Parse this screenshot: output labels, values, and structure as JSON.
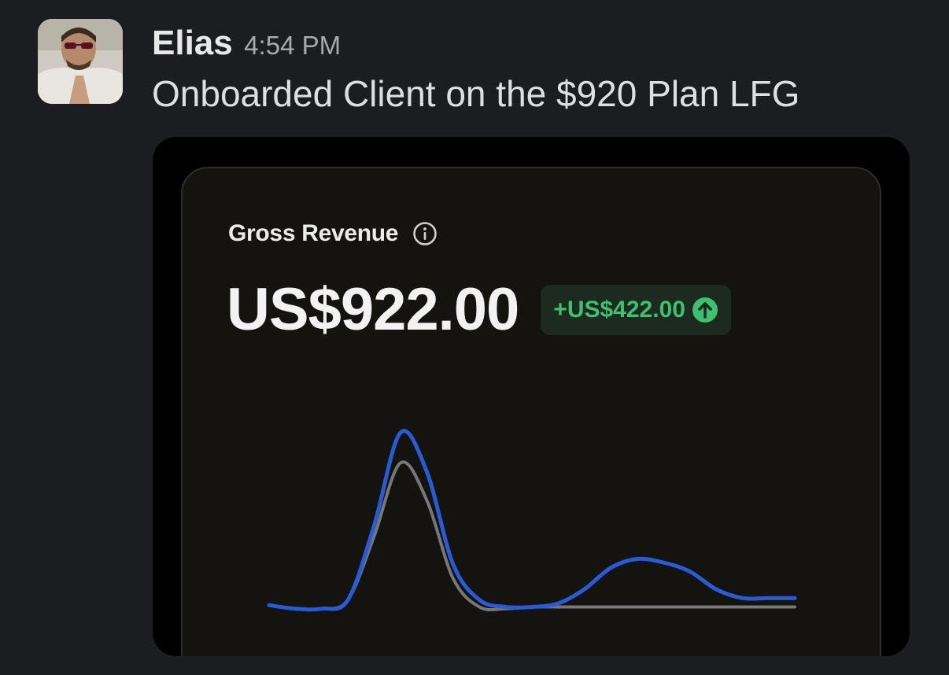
{
  "message": {
    "author": "Elias",
    "timestamp": "4:54 PM",
    "text": "Onboarded Client on the $920 Plan LFG"
  },
  "card": {
    "title": "Gross Revenue",
    "amount": "US$922.00",
    "delta": "+US$422.00",
    "delta_color": "#3fbf6f",
    "icons": [
      "info-icon",
      "arrow-up-circle-icon"
    ]
  },
  "chart_data": {
    "type": "line",
    "title": "",
    "xlabel": "",
    "ylabel": "",
    "grid": false,
    "x": [
      0,
      1,
      2,
      3,
      4,
      5,
      6,
      7,
      8,
      9,
      10,
      11,
      12,
      13,
      14,
      15,
      16,
      17,
      18,
      19,
      20
    ],
    "ylim": [
      0,
      100
    ],
    "series": [
      {
        "color": "#2a5bd7",
        "values": [
          3,
          1,
          1,
          6,
          48,
          100,
          78,
          26,
          6,
          2,
          2,
          4,
          12,
          24,
          29,
          27,
          22,
          12,
          7,
          7,
          7
        ]
      },
      {
        "color": "#777777",
        "values": [
          3,
          1,
          1,
          6,
          42,
          83,
          62,
          18,
          2,
          1,
          2,
          2,
          2,
          2,
          2,
          2,
          2,
          2,
          2,
          2,
          2
        ]
      }
    ]
  }
}
